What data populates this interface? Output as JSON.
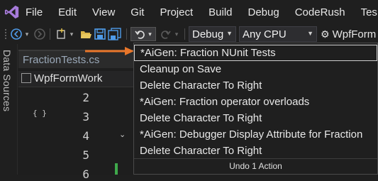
{
  "menu": {
    "logo": "visual-studio-logo-icon",
    "items": [
      "File",
      "Edit",
      "View",
      "Git",
      "Project",
      "Build",
      "Debug",
      "CodeRush",
      "Tes"
    ]
  },
  "toolbar": {
    "configuration": "Debug",
    "platform": "Any CPU",
    "startup_project": "WpfForm"
  },
  "side_panel": {
    "label": "Data Sources"
  },
  "document": {
    "tab_label": "FractionTests.cs",
    "nav_class": "WpfFormWork",
    "line_numbers": [
      "2",
      "3",
      "4",
      "5",
      "6"
    ]
  },
  "undo_dropdown": {
    "items": [
      "*AiGen: Fraction NUnit Tests",
      "Cleanup on Save",
      "Delete Character To Right",
      "*AiGen: Fraction operator overloads",
      "Delete Character To Right",
      "*AiGen: Debugger Display Attribute for Fraction",
      "Delete Character To Right"
    ],
    "selected_index": 0,
    "footer": "Undo 1 Action"
  },
  "colors": {
    "background": "#1f1f1f",
    "accent_arrow": "#e8762a",
    "logo_purple": "#a77bdb",
    "change_marker": "#3fa94b"
  }
}
